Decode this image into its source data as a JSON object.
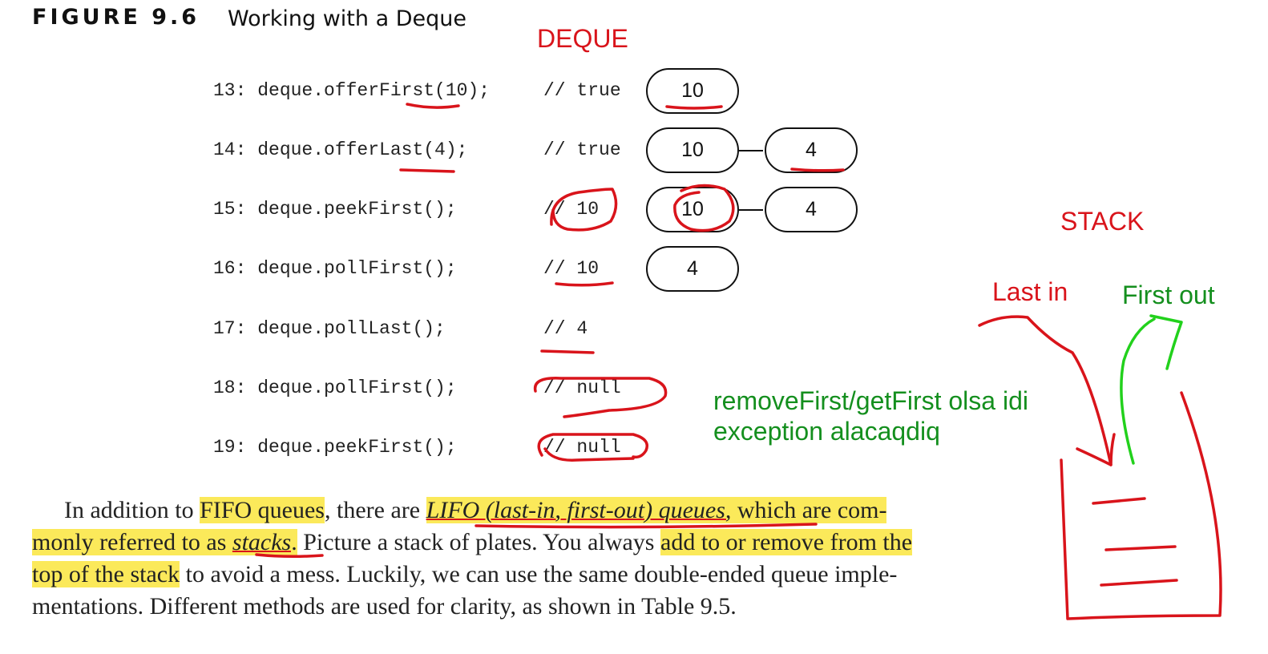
{
  "figure": {
    "label": "FIGURE 9.6",
    "title": "Working with a Deque"
  },
  "annotations": {
    "deque_label": "DEQUE",
    "stack_label": "STACK",
    "last_in": "Last in",
    "first_out": "First out",
    "note_line1": "removeFirst/getFirst olsa idi",
    "note_line2": "exception alacaqdiq"
  },
  "code_lines": [
    {
      "code": "13: deque.offerFirst(10);",
      "comment": "// true"
    },
    {
      "code": "14: deque.offerLast(4);",
      "comment": "// true"
    },
    {
      "code": "15: deque.peekFirst();",
      "comment": "// 10"
    },
    {
      "code": "16: deque.pollFirst();",
      "comment": "// 10"
    },
    {
      "code": "17: deque.pollLast();",
      "comment": "// 4"
    },
    {
      "code": "18: deque.pollFirst();",
      "comment": "// null"
    },
    {
      "code": "19: deque.peekFirst();",
      "comment": "// null"
    }
  ],
  "deque_states": [
    [
      "10"
    ],
    [
      "10",
      "4"
    ],
    [
      "10",
      "4"
    ],
    [
      "4"
    ]
  ],
  "paragraph": {
    "l1a": "In addition to ",
    "l1b": "FIFO queues",
    "l1c": ", there are ",
    "l1d": "LIFO (last-in, first-out) queues,",
    "l1e": " which are com-",
    "l2a": "monly referred to as ",
    "l2b": "stacks",
    "l2c": ".",
    "l2d": " Picture a stack of plates. You always ",
    "l2e": "add to or remove from the",
    "l3a": "top of the stack",
    "l3b": " to avoid a mess. Luckily, we can use the same double-ended queue imple-",
    "l4": "mentations. Different methods are used for clarity, as shown in Table 9.5."
  },
  "colors": {
    "ink_red": "#d9141b",
    "ink_green": "#22d11c",
    "highlight": "#fbe95a"
  }
}
